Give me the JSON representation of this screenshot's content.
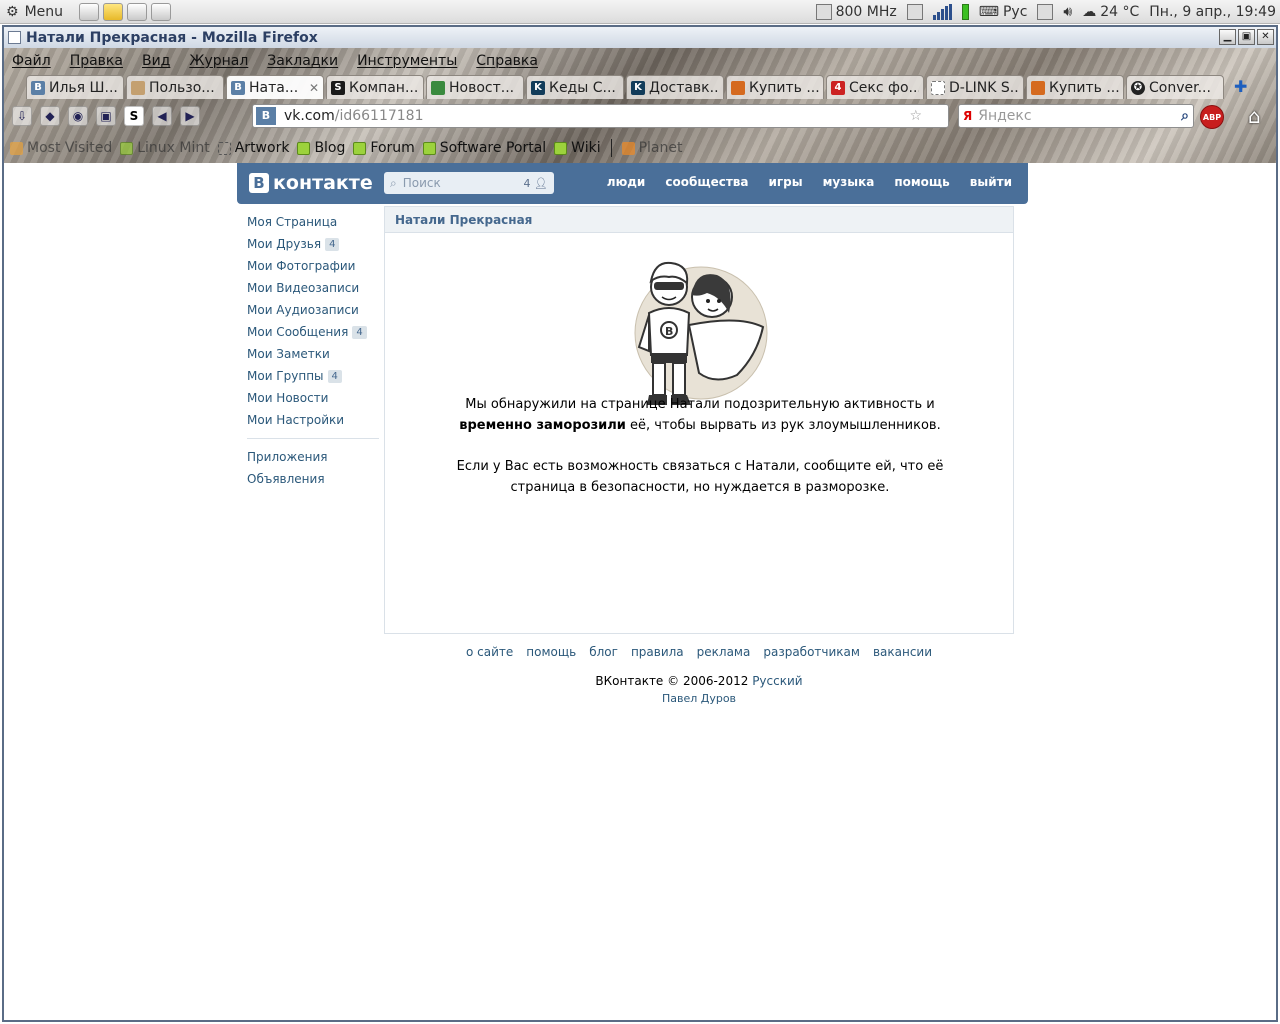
{
  "panel": {
    "menu_label": "Menu",
    "cpu": "800 MHz",
    "lang": "Рус",
    "temp": "24 °C",
    "datetime": "Пн., 9 апр., 19:49"
  },
  "window": {
    "title": "Натали Прекрасная - Mozilla Firefox"
  },
  "menubar": [
    "Файл",
    "Правка",
    "Вид",
    "Журнал",
    "Закладки",
    "Инструменты",
    "Справка"
  ],
  "tabs": [
    {
      "label": "Илья Ш...",
      "icon": "vk"
    },
    {
      "label": "Пользо...",
      "icon": "e"
    },
    {
      "label": "Ната...",
      "icon": "vk",
      "active": true
    },
    {
      "label": "Компан...",
      "icon": "s"
    },
    {
      "label": "Новост...",
      "icon": "g"
    },
    {
      "label": "Кеды С...",
      "icon": "k"
    },
    {
      "label": "Доставк...",
      "icon": "k"
    },
    {
      "label": "Купить ...",
      "icon": "o"
    },
    {
      "label": "Секс фо...",
      "icon": "r"
    },
    {
      "label": "D-LINK S...",
      "icon": "w"
    },
    {
      "label": "Купить ...",
      "icon": "o"
    },
    {
      "label": "Conver...",
      "icon": "b"
    }
  ],
  "urlbar": {
    "domain": "vk.com",
    "path": "/id66117181"
  },
  "searchbar": {
    "placeholder": "Яндекс",
    "engine": "Я"
  },
  "abp_label": "ABP",
  "bookmarks": [
    {
      "label": "Most Visited",
      "icon": "fold",
      "dim": true
    },
    {
      "label": "Linux Mint",
      "icon": "mint",
      "dim": true
    },
    {
      "label": "Artwork",
      "icon": "dash"
    },
    {
      "label": "Blog",
      "icon": "mint"
    },
    {
      "label": "Forum",
      "icon": "mint"
    },
    {
      "label": "Software Portal",
      "icon": "mint"
    },
    {
      "label": "Wiki",
      "icon": "mint"
    },
    {
      "label": "Planet",
      "icon": "rss",
      "dim": true
    }
  ],
  "vk": {
    "logo_letter": "В",
    "logo_text": "контакте",
    "search_placeholder": "Поиск",
    "search_count": "4",
    "nav": [
      "люди",
      "сообщества",
      "игры",
      "музыка",
      "помощь",
      "выйти"
    ],
    "sidebar": [
      {
        "label": "Моя Страница"
      },
      {
        "label": "Мои Друзья",
        "badge": "4"
      },
      {
        "label": "Мои Фотографии"
      },
      {
        "label": "Мои Видеозаписи"
      },
      {
        "label": "Мои Аудиозаписи"
      },
      {
        "label": "Мои Сообщения",
        "badge": "4"
      },
      {
        "label": "Мои Заметки"
      },
      {
        "label": "Мои Группы",
        "badge": "4"
      },
      {
        "label": "Мои Новости"
      },
      {
        "label": "Мои Настройки"
      }
    ],
    "sidebar_extra": [
      "Приложения",
      "Объявления"
    ],
    "profile_name": "Натали Прекрасная",
    "msg1_a": "Мы обнаружили на странице Натали подозрительную активность и",
    "msg1_b": "временно заморозили",
    "msg1_c": " её, чтобы вырвать из рук злоумышленников.",
    "msg2": "Если у Вас есть возможность связаться с Натали, сообщите ей, что её страница в безопасности, но нуждается в разморозке.",
    "footer_links": [
      "о сайте",
      "помощь",
      "блог",
      "правила",
      "реклама",
      "разработчикам",
      "вакансии"
    ],
    "copyright": "ВКонтакте © 2006-2012",
    "language": "Русский",
    "author": "Павел Дуров"
  }
}
